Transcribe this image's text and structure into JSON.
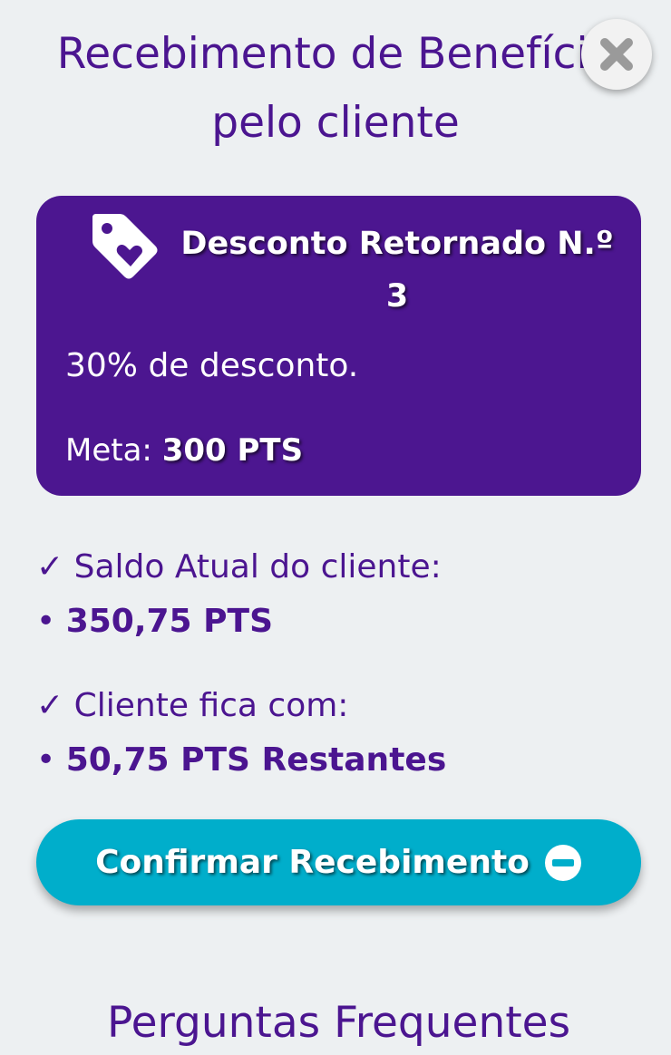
{
  "header": {
    "title": "Recebimento de Benefício pelo cliente",
    "close_icon": "close-icon"
  },
  "benefit_card": {
    "icon": "tag-heart-icon",
    "title": "Desconto Retornado N.º 3",
    "description": "30% de desconto.",
    "meta_label": "Meta:",
    "meta_value": "300 PTS",
    "background_color": "#4c1690"
  },
  "balance": {
    "check_mark": "✓",
    "label": "Saldo Atual do cliente:",
    "bullet": "•",
    "value": "350,75 PTS"
  },
  "remaining": {
    "check_mark": "✓",
    "label": "Cliente fica com:",
    "bullet": "•",
    "value": "50,75 PTS Restantes"
  },
  "confirm_button": {
    "label": "Confirmar Recebimento",
    "icon": "minus-circle-icon",
    "color": "#00aecb"
  },
  "faq": {
    "title": "Perguntas Frequentes"
  },
  "colors": {
    "primary_purple": "#4b1590",
    "background": "#edf0f2",
    "accent_cyan": "#00aecb"
  }
}
